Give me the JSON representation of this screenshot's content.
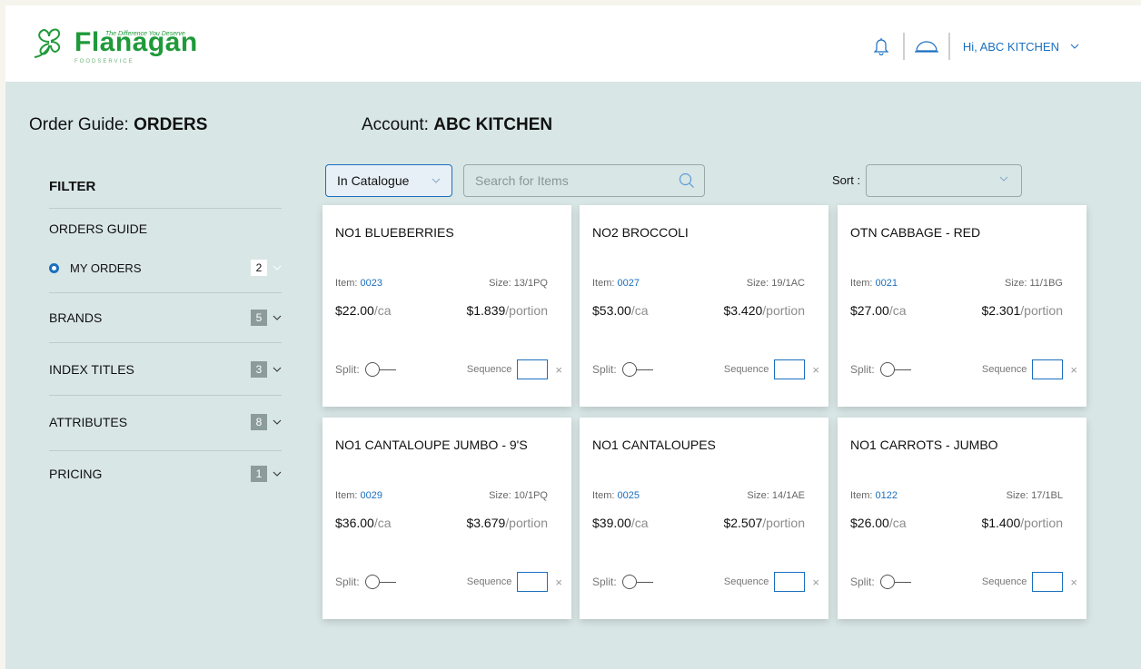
{
  "brand": {
    "name": "Flanagan",
    "tagline": "The Difference You Deserve",
    "sub": "FOODSERVICE",
    "color": "#1f9a3a"
  },
  "header": {
    "greeting": "Hi, ABC KITCHEN",
    "icons": [
      "bell-icon",
      "cloche-icon",
      "chevron-down-icon"
    ]
  },
  "page": {
    "order_guide_label": "Order Guide:",
    "order_guide_value": "ORDERS",
    "account_label": "Account:",
    "account_value": "ABC KITCHEN"
  },
  "filter": {
    "title": "FILTER",
    "orders_guide": "ORDERS GUIDE",
    "my_orders": {
      "label": "MY ORDERS",
      "count": "2"
    },
    "sections": [
      {
        "label": "BRANDS",
        "count": "5"
      },
      {
        "label": "INDEX TITLES",
        "count": "3"
      },
      {
        "label": "ATTRIBUTES",
        "count": "8"
      },
      {
        "label": "PRICING",
        "count": "1"
      }
    ]
  },
  "toolbar": {
    "catalogue_select": "In Catalogue",
    "search_placeholder": "Search for Items",
    "sort_label": "Sort :",
    "sort_value": ""
  },
  "labels": {
    "item": "Item: ",
    "size": "Size: ",
    "per_case": "/ca",
    "per_portion": "/portion",
    "split": "Split:",
    "sequence": "Sequence",
    "clear": "×"
  },
  "products": [
    {
      "name": "NO1 BLUEBERRIES",
      "item": "0023",
      "size": "13/1PQ",
      "price": "$22.00",
      "portion_price": "$1.839"
    },
    {
      "name": "NO2 BROCCOLI",
      "item": "0027",
      "size": "19/1AC",
      "price": "$53.00",
      "portion_price": "$3.420"
    },
    {
      "name": "OTN CABBAGE - RED",
      "item": "0021",
      "size": "11/1BG",
      "price": "$27.00",
      "portion_price": "$2.301"
    },
    {
      "name": "NO1 CANTALOUPE JUMBO - 9'S",
      "item": "0029",
      "size": "10/1PQ",
      "price": "$36.00",
      "portion_price": "$3.679"
    },
    {
      "name": "NO1 CANTALOUPES",
      "item": "0025",
      "size": "14/1AE",
      "price": "$39.00",
      "portion_price": "$2.507"
    },
    {
      "name": "NO1 CARROTS - JUMBO",
      "item": "0122",
      "size": "17/1BL",
      "price": "$26.00",
      "portion_price": "$1.400"
    }
  ],
  "colors": {
    "accent": "#1a6fbf",
    "background": "#d8e6e5",
    "badge": "#8b9c9a"
  }
}
